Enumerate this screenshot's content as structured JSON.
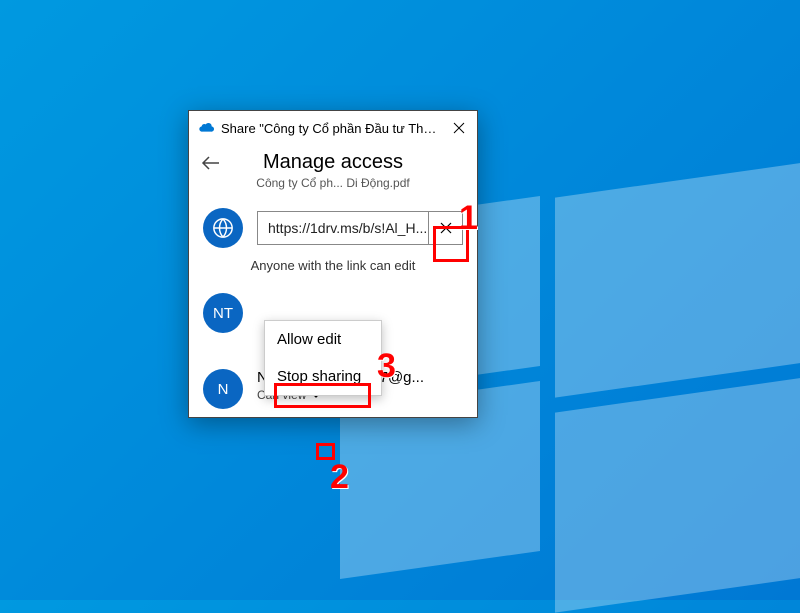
{
  "titlebar": {
    "title": "Share \"Công ty Cổ phần Đầu tư Thế Giới Di Độ..."
  },
  "header": {
    "title": "Manage access",
    "subtitle": "Công ty Cổ ph... Di Động.pdf"
  },
  "link": {
    "url": "https://1drv.ms/b/s!Al_H...",
    "description": "Anyone with the link can edit"
  },
  "people": [
    {
      "initials": "NT",
      "name": "",
      "permission": ""
    },
    {
      "initials": "N",
      "name": "Nguyentuan993107@g...",
      "permission": "Can view"
    }
  ],
  "menu": {
    "allow": "Allow edit",
    "stop": "Stop sharing"
  },
  "annotations": {
    "a1": "1",
    "a2": "2",
    "a3": "3"
  }
}
